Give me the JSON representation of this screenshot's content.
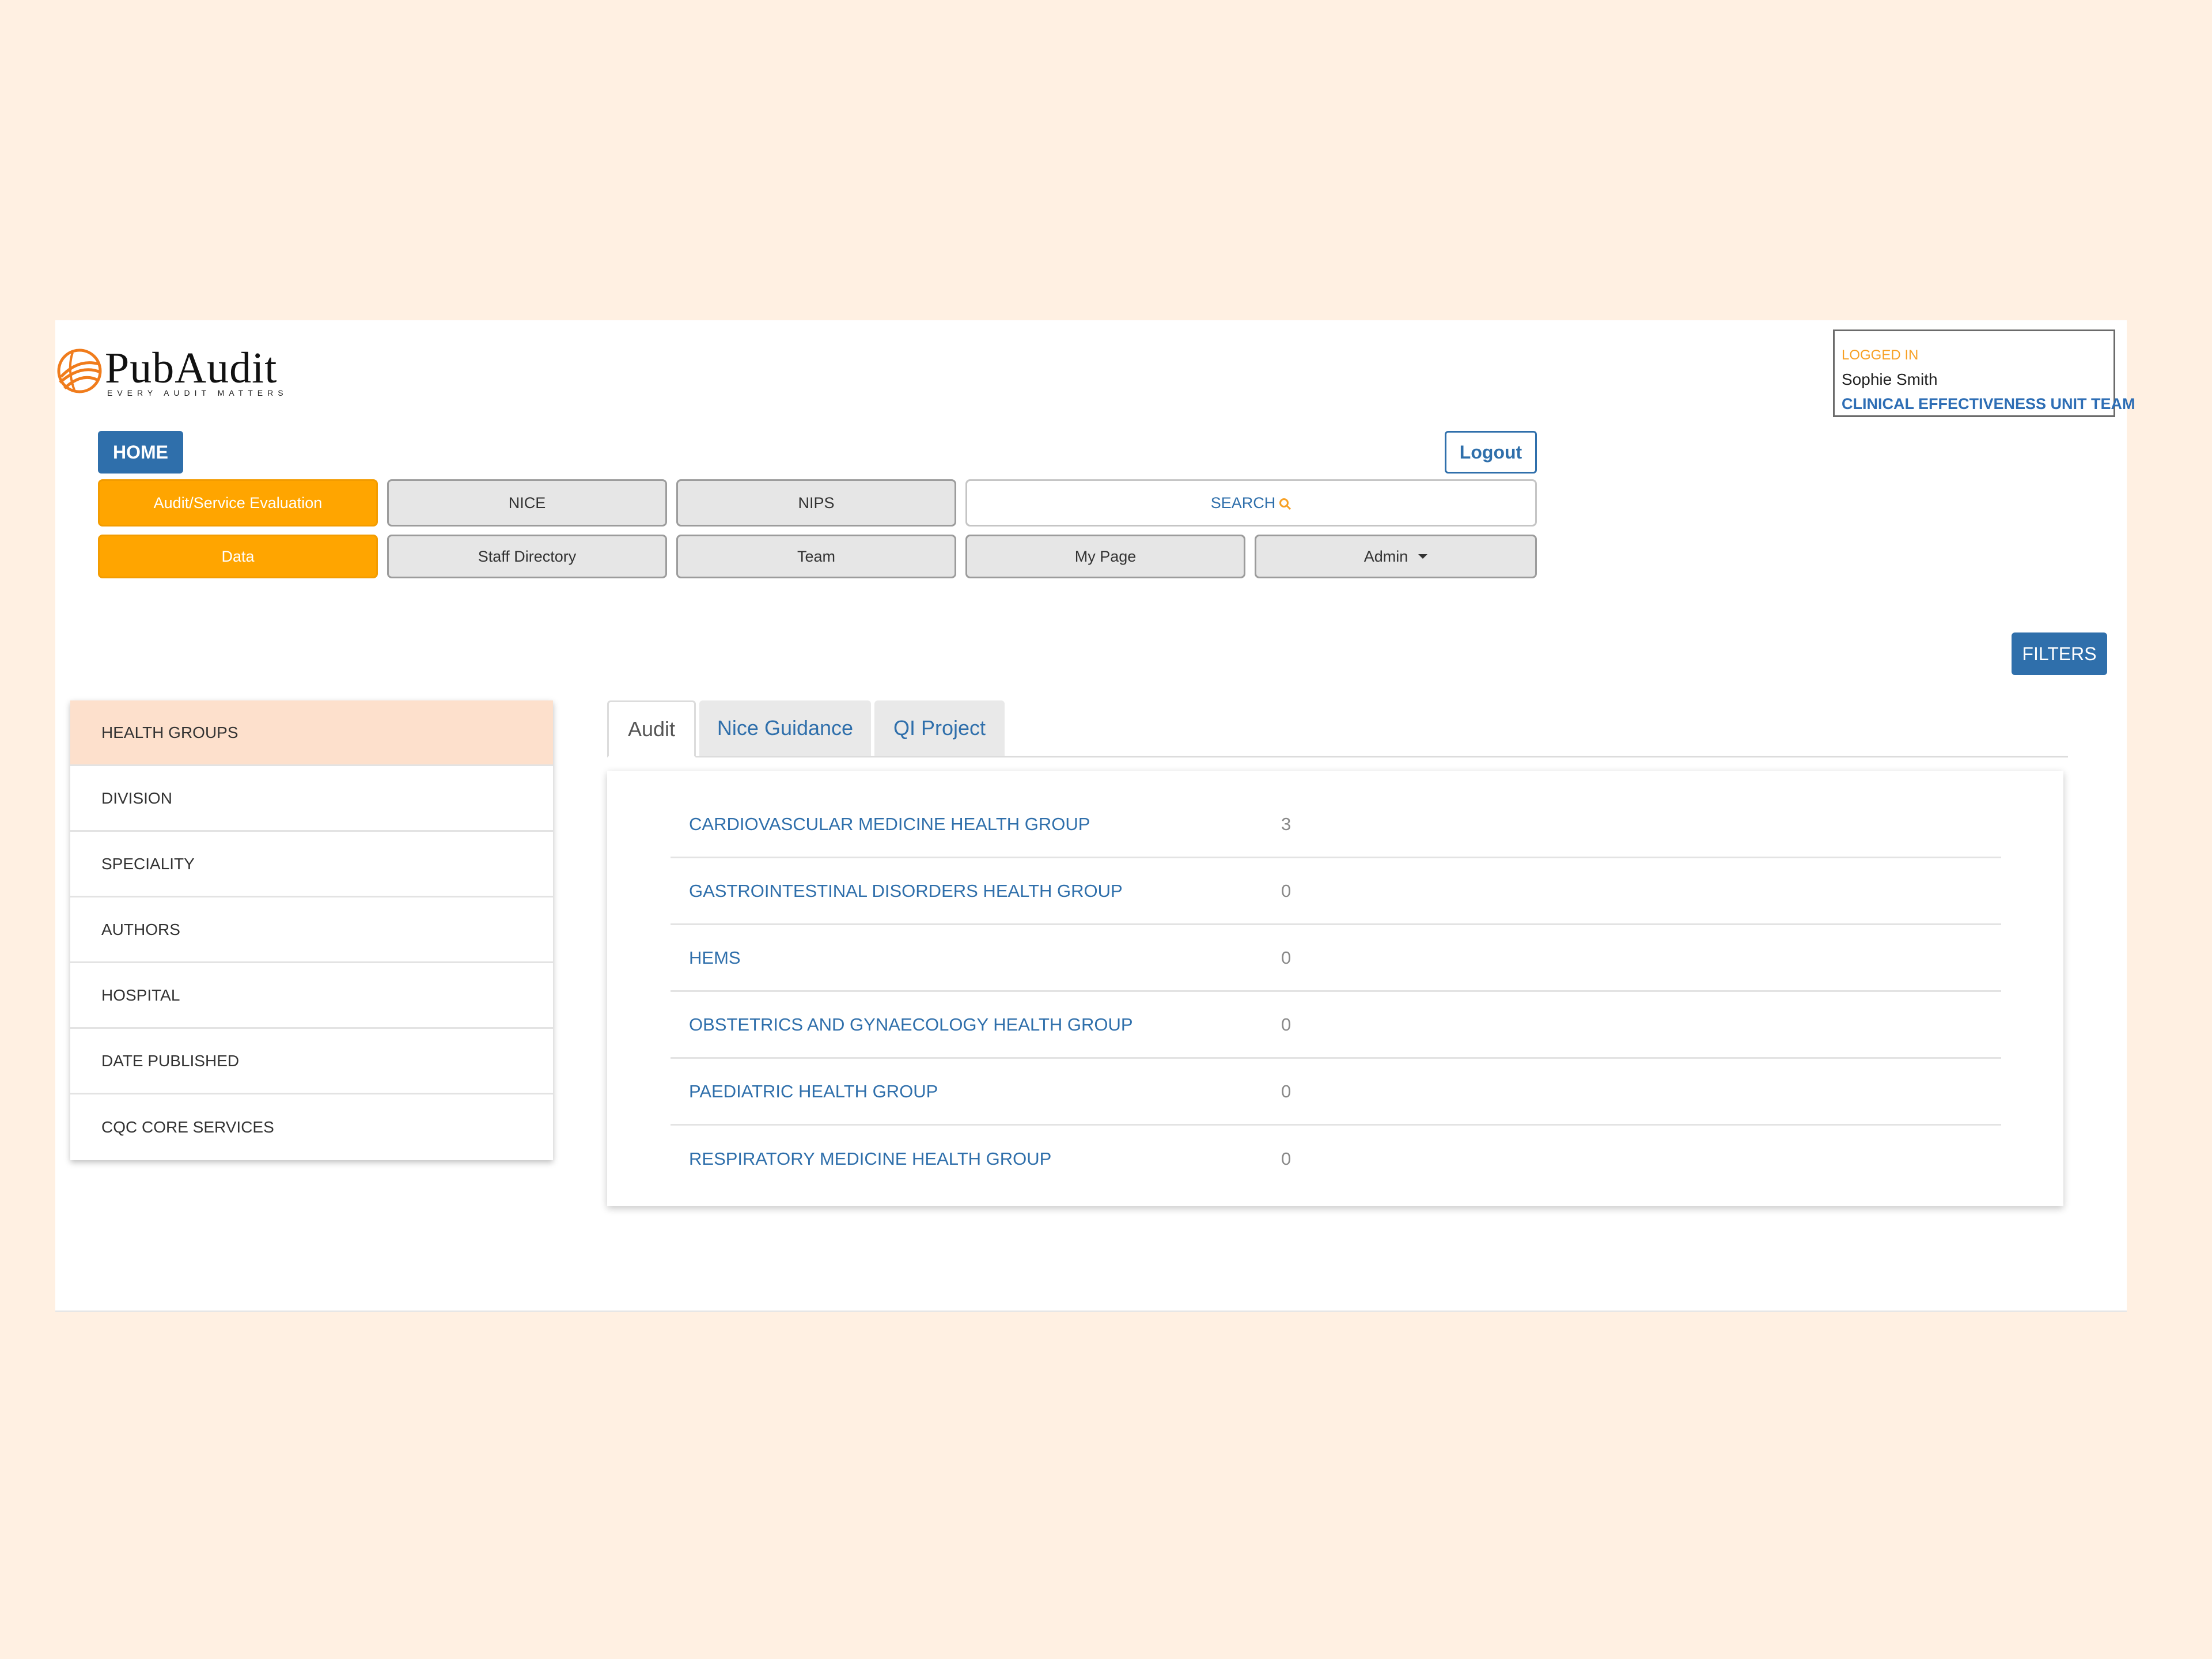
{
  "logo": {
    "name": "PubAudit",
    "tagline": "EVERY AUDIT MATTERS"
  },
  "login": {
    "label": "LOGGED IN",
    "user": "Sophie Smith",
    "team": "CLINICAL EFFECTIVENESS UNIT TEAM"
  },
  "header": {
    "home": "HOME",
    "logout": "Logout"
  },
  "nav": {
    "row1": [
      "Audit/Service Evaluation",
      "NICE",
      "NIPS",
      "SEARCH"
    ],
    "row2": [
      "Data",
      "Staff Directory",
      "Team",
      "My Page",
      "Admin"
    ]
  },
  "filters_label": "FILTERS",
  "sidebar": {
    "items": [
      {
        "label": "HEALTH GROUPS",
        "active": true
      },
      {
        "label": "DIVISION"
      },
      {
        "label": "SPECIALITY"
      },
      {
        "label": "AUTHORS"
      },
      {
        "label": "HOSPITAL"
      },
      {
        "label": "DATE PUBLISHED"
      },
      {
        "label": "CQC CORE SERVICES"
      }
    ]
  },
  "tabs": [
    {
      "label": "Audit",
      "active": true
    },
    {
      "label": "Nice Guidance"
    },
    {
      "label": "QI Project"
    }
  ],
  "table": {
    "rows": [
      {
        "name": "CARDIOVASCULAR MEDICINE HEALTH GROUP",
        "count": "3"
      },
      {
        "name": "GASTROINTESTINAL DISORDERS HEALTH GROUP",
        "count": "0"
      },
      {
        "name": "HEMS",
        "count": "0"
      },
      {
        "name": "OBSTETRICS AND GYNAECOLOGY HEALTH GROUP",
        "count": "0"
      },
      {
        "name": "PAEDIATRIC HEALTH GROUP",
        "count": "0"
      },
      {
        "name": "RESPIRATORY MEDICINE HEALTH GROUP",
        "count": "0"
      }
    ]
  },
  "colors": {
    "background": "#fff0e2",
    "primary_blue": "#2f6fab",
    "orange": "#ffa500",
    "active_sidebar": "#fde0cc"
  }
}
